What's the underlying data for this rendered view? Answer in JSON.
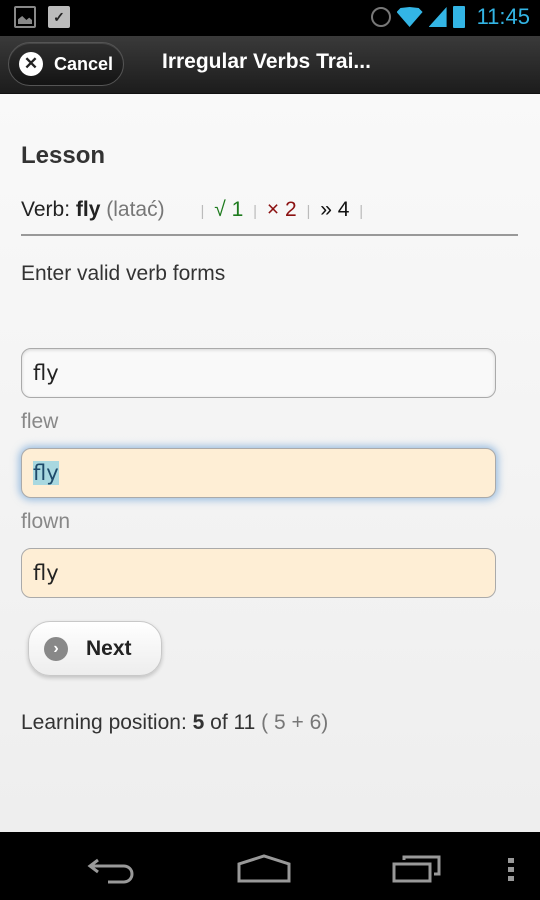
{
  "status_bar": {
    "time": "11:45",
    "left_icons": [
      "image-icon",
      "shopping-bag-icon"
    ],
    "right_icons": [
      "alarm-icon",
      "wifi-icon",
      "signal-icon",
      "battery-icon"
    ],
    "accent_color": "#33b5e5"
  },
  "action_bar": {
    "cancel_label": "Cancel",
    "title": "Irregular Verbs Trai..."
  },
  "lesson": {
    "heading": "Lesson",
    "verb_prefix": "Verb: ",
    "verb": "fly",
    "translation": "(latać)",
    "stats": {
      "correct_symbol": "√",
      "correct_count": "1",
      "wrong_symbol": "×",
      "wrong_count": "2",
      "skip_symbol": "»",
      "skip_count": "4",
      "separator": "|"
    },
    "instruction": "Enter valid verb forms",
    "fields": [
      {
        "name": "base-form",
        "value": "fly",
        "hint": ""
      },
      {
        "name": "past-simple",
        "value": "fly",
        "hint": "flew"
      },
      {
        "name": "past-participle",
        "value": "fly",
        "hint": "flown"
      }
    ],
    "next_label": "Next",
    "position": {
      "label": "Learning position: ",
      "current": "5",
      "of_text": " of 11",
      "breakdown": " ( 5 + 6)"
    }
  },
  "colors": {
    "correct": "#1e7b1e",
    "wrong": "#8b1111",
    "field_highlight": "#feeed5"
  }
}
